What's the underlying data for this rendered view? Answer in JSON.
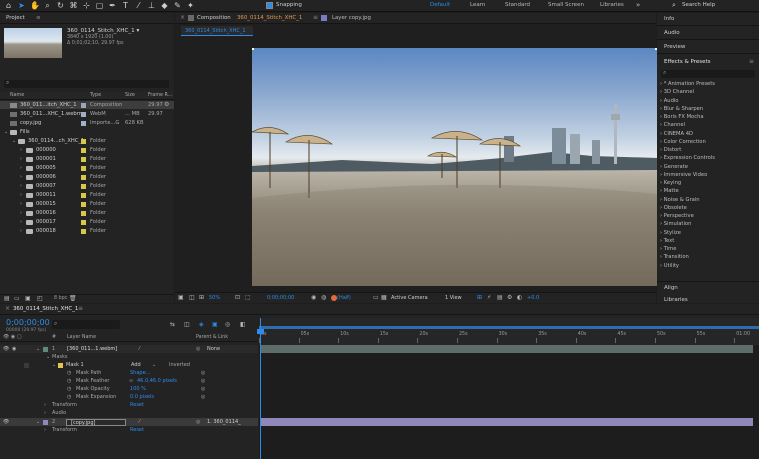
{
  "toolbar": {
    "snapping": "Snapping",
    "workspaces": [
      "Default",
      "Learn",
      "Standard",
      "Small Screen",
      "Libraries"
    ],
    "search_placeholder": "Search Help",
    "tool_icons": [
      "home-icon",
      "selection-tool-icon",
      "hand-tool-icon",
      "zoom-tool-icon",
      "rotate-tool-icon",
      "camera-tool-icon",
      "pan-behind-tool-icon",
      "rectangle-tool-icon",
      "pen-tool-icon",
      "type-tool-icon",
      "brush-tool-icon",
      "clone-stamp-tool-icon",
      "eraser-tool-icon",
      "roto-brush-tool-icon",
      "puppet-tool-icon"
    ]
  },
  "project": {
    "title": "Project",
    "preview_name": "360_0114_Stitch_XHC_1 ▾",
    "preview_dims": "3840 x 1920 (1.00)",
    "preview_duration": "Δ 0;01;02;10, 29.97 fps",
    "columns": [
      "Name",
      "Type",
      "Size",
      "Frame R..."
    ],
    "items": [
      {
        "name": "360_011...itch_XHC_1",
        "type": "Composition",
        "size": "",
        "fps": "29.97",
        "kind": "comp",
        "level": 0,
        "selected": true
      },
      {
        "name": "360_011...XHC_1.webm",
        "type": "WebM",
        "size": "... MB",
        "fps": "29.97",
        "kind": "footage",
        "level": 0
      },
      {
        "name": "copy.jpg",
        "type": "Importe...G",
        "size": "628 KB",
        "fps": "",
        "kind": "footage",
        "level": 0
      },
      {
        "name": "Fills",
        "type": "",
        "size": "",
        "fps": "",
        "kind": "folder-open",
        "level": 0
      },
      {
        "name": "360_0114...ch_XHC_1",
        "type": "Folder",
        "size": "",
        "fps": "",
        "kind": "folder-open",
        "level": 1
      },
      {
        "name": "000000",
        "type": "Folder",
        "size": "",
        "fps": "",
        "kind": "folder",
        "level": 2
      },
      {
        "name": "000001",
        "type": "Folder",
        "size": "",
        "fps": "",
        "kind": "folder",
        "level": 2
      },
      {
        "name": "000005",
        "type": "Folder",
        "size": "",
        "fps": "",
        "kind": "folder",
        "level": 2
      },
      {
        "name": "000006",
        "type": "Folder",
        "size": "",
        "fps": "",
        "kind": "folder",
        "level": 2
      },
      {
        "name": "000007",
        "type": "Folder",
        "size": "",
        "fps": "",
        "kind": "folder",
        "level": 2
      },
      {
        "name": "000011",
        "type": "Folder",
        "size": "",
        "fps": "",
        "kind": "folder",
        "level": 2
      },
      {
        "name": "000015",
        "type": "Folder",
        "size": "",
        "fps": "",
        "kind": "folder",
        "level": 2
      },
      {
        "name": "000016",
        "type": "Folder",
        "size": "",
        "fps": "",
        "kind": "folder",
        "level": 2
      },
      {
        "name": "000017",
        "type": "Folder",
        "size": "",
        "fps": "",
        "kind": "folder",
        "level": 2
      },
      {
        "name": "000018",
        "type": "Folder",
        "size": "",
        "fps": "",
        "kind": "folder",
        "level": 2
      }
    ],
    "bpc": "8 bpc"
  },
  "composition": {
    "tab1": "Composition",
    "tab1_name": "360_0114_Stitch_XHC_1",
    "tab2": "Layer  copy.jpg",
    "subtab": "360_0114_Stitch_XHC_1",
    "zoom": "50%",
    "timecode": "0;00;00;00",
    "resolution": "(Half)",
    "camera": "Active Camera",
    "views": "1 View",
    "exposure": "+0.0"
  },
  "right_panel": {
    "info": "Info",
    "audio": "Audio",
    "preview": "Preview",
    "effects_title": "Effects & Presets",
    "effects": [
      "* Animation Presets",
      "3D Channel",
      "Audio",
      "Blur & Sharpen",
      "Boris FX Mocha",
      "Channel",
      "CINEMA 4D",
      "Color Correction",
      "Distort",
      "Expression Controls",
      "Generate",
      "Immersive Video",
      "Keying",
      "Matte",
      "Noise & Grain",
      "Obsolete",
      "Perspective",
      "Simulation",
      "Stylize",
      "Text",
      "Time",
      "Transition",
      "Utility"
    ],
    "align": "Align",
    "libraries": "Libraries"
  },
  "timeline": {
    "tab_name": "360_0114_Stitch_XHC_1",
    "timecode": "0;00;00;00",
    "frames": "00000 (29.97 fps)",
    "search_placeholder": "",
    "col_num": "#",
    "col_layer": "Layer Name",
    "col_parent": "Parent & Link",
    "ruler": [
      "0s",
      "05s",
      "10s",
      "15s",
      "20s",
      "25s",
      "30s",
      "35s",
      "40s",
      "45s",
      "50s",
      "55s",
      "01:00",
      "01:0"
    ],
    "layer1": {
      "num": "1",
      "name": "[360_011...1.webm]",
      "parent": "None"
    },
    "masks": "Masks",
    "mask1": "Mask 1",
    "mask_mode": "Add",
    "inverted": "Inverted",
    "mask_path": "Mask Path",
    "mask_path_value": "Shape...",
    "mask_feather": "Mask Feather",
    "mask_feather_value": "46.0,46.0 pixels",
    "mask_opacity": "Mask Opacity",
    "mask_opacity_value": "100 %",
    "mask_expansion": "Mask Expansion",
    "mask_expansion_value": "0.0 pixels",
    "transform": "Transform",
    "transform_reset": "Reset",
    "audio": "Audio",
    "layer2": {
      "num": "2",
      "name": "[copy.jpg]",
      "parent": "1. 360_0114_"
    },
    "transform2": "Transform",
    "transform2_reset": "Reset"
  },
  "colors": {
    "accent": "#2d8ceb",
    "folder_label": "#d8c84a",
    "layer1_bar": "#5d6e6a",
    "layer2_bar": "#8f88b8",
    "panel_bg": "#232323"
  }
}
